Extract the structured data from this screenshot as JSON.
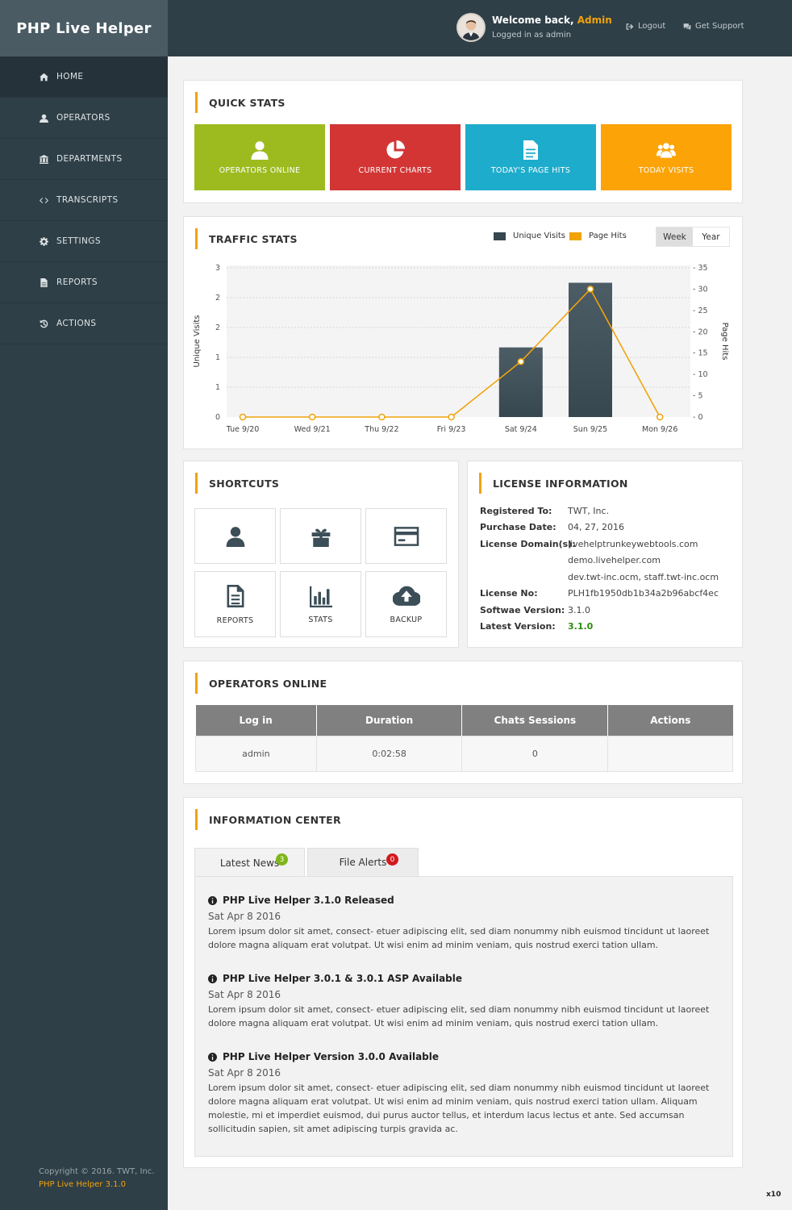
{
  "brand": "PHP Live Helper",
  "sidebar": {
    "items": [
      {
        "label": "HOME",
        "icon": "home-icon"
      },
      {
        "label": "OPERATORS",
        "icon": "user-icon"
      },
      {
        "label": "DEPARTMENTS",
        "icon": "bank-icon"
      },
      {
        "label": "TRANSCRIPTS",
        "icon": "code-icon"
      },
      {
        "label": "SETTINGS",
        "icon": "gear-icon"
      },
      {
        "label": "REPORTS",
        "icon": "file-icon"
      },
      {
        "label": "ACTIONS",
        "icon": "history-icon"
      }
    ],
    "copyright": "Copyright © 2016. TWT, Inc.",
    "version": "PHP Live Helper 3.1.0"
  },
  "header": {
    "welcome": "Welcome back,",
    "user": "Admin",
    "logged_in": "Logged in as admin",
    "logout": "Logout",
    "support": "Get Support"
  },
  "quick_stats": {
    "title": "QUICK STATS",
    "tiles": [
      {
        "label": "OPERATORS ONLINE",
        "color": "#9dbb1f",
        "icon": "user-icon"
      },
      {
        "label": "CURRENT CHARTS",
        "color": "#d33535",
        "icon": "pie-chart-icon"
      },
      {
        "label": "TODAY'S PAGE HITS",
        "color": "#1eaccc",
        "icon": "document-icon"
      },
      {
        "label": "TODAY VISITS",
        "color": "#fca308",
        "icon": "users-icon"
      }
    ]
  },
  "traffic": {
    "title": "TRAFFIC STATS",
    "legend_visits": "Unique Visits",
    "legend_hits": "Page Hits",
    "week": "Week",
    "year": "Year"
  },
  "chart_data": {
    "type": "bar",
    "categories": [
      "Tue 9/20",
      "Wed 9/21",
      "Thu 9/22",
      "Fri 9/23",
      "Sat 9/24",
      "Sun 9/25",
      "Mon 9/26"
    ],
    "series": [
      {
        "name": "Unique Visits",
        "type": "bar",
        "axis": "left",
        "color": "#37474f",
        "values": [
          0,
          0,
          0,
          0,
          1.4,
          2.7,
          0
        ]
      },
      {
        "name": "Page Hits",
        "type": "line",
        "axis": "right",
        "color": "#f0a30a",
        "values": [
          0,
          0,
          0,
          0,
          13,
          30,
          0
        ]
      }
    ],
    "ylabel": "Unique Visits",
    "y2label": "Page Hits",
    "yticks": [
      "3",
      "2",
      "2",
      "1",
      "1",
      "0"
    ],
    "ylim": [
      0,
      3
    ],
    "y2ticks": [
      "35",
      "30",
      "25",
      "20",
      "15",
      "10",
      "5",
      "0"
    ],
    "y2lim": [
      0,
      35
    ],
    "grid": true,
    "legend": "top-right"
  },
  "shortcuts": {
    "title": "SHORTCUTS",
    "items": [
      {
        "label": "",
        "icon": "user-icon"
      },
      {
        "label": "",
        "icon": "gift-icon"
      },
      {
        "label": "",
        "icon": "credit-card-icon"
      },
      {
        "label": "REPORTS",
        "icon": "document-icon"
      },
      {
        "label": "STATS",
        "icon": "bar-chart-icon"
      },
      {
        "label": "BACKUP",
        "icon": "cloud-upload-icon"
      }
    ]
  },
  "license": {
    "title": "LICENSE INFORMATION",
    "registered_to_label": "Registered To:",
    "registered_to": "TWT, Inc.",
    "purchase_date_label": "Purchase Date:",
    "purchase_date": "04, 27, 2016",
    "domains_label": "License Domain(s):",
    "domain1": "livehelptrunkeywebtools.com",
    "domain2": "demo.livehelper.com",
    "domain3": "dev.twt-inc.ocm,  staff.twt-inc.ocm",
    "license_no_label": "License No:",
    "license_no": "PLH1fb1950db1b34a2b96abcf4ec",
    "software_version_label": "Softwae Version:",
    "software_version": "3.1.0",
    "latest_version_label": "Latest Version:",
    "latest_version": "3.1.0",
    "latest_color": "#2e8b0e"
  },
  "operators": {
    "title": "OPERATORS ONLINE",
    "columns": [
      "Log in",
      "Duration",
      "Chats Sessions",
      "Actions"
    ],
    "rows": [
      [
        "admin",
        "0:02:58",
        "0",
        ""
      ]
    ]
  },
  "info": {
    "title": "INFORMATION CENTER",
    "tab_news": "Latest News",
    "news_count": "3",
    "tab_alerts": "File Alerts",
    "alerts_count": "0",
    "news": [
      {
        "title": "PHP Live Helper 3.1.0 Released",
        "date": "Sat Apr 8 2016",
        "body": "Lorem ipsum dolor sit amet, consect- etuer adipiscing elit, sed diam nonummy nibh euismod tincidunt ut laoreet dolore magna aliquam erat volutpat. Ut wisi enim ad minim veniam, quis nostrud exerci tation ullam."
      },
      {
        "title": "PHP Live Helper 3.0.1 & 3.0.1 ASP Available",
        "date": "Sat Apr 8 2016",
        "body": "Lorem ipsum dolor sit amet, consect- etuer adipiscing elit, sed diam nonummy nibh euismod tincidunt ut laoreet dolore magna aliquam erat volutpat. Ut wisi enim ad minim veniam, quis nostrud exerci tation ullam."
      },
      {
        "title": "PHP Live Helper Version 3.0.0 Available",
        "date": "Sat Apr 8 2016",
        "body": "Lorem ipsum dolor sit amet, consect- etuer adipiscing elit, sed diam nonummy nibh euismod tincidunt ut laoreet dolore magna aliquam erat volutpat. Ut wisi enim ad minim veniam, quis nostrud exerci tation ullam. Aliquam molestie, mi et imperdiet euismod, dui purus auctor tellus, et interdum lacus lectus et ante. Sed accumsan sollicitudin sapien, sit amet adipiscing turpis gravida ac."
      }
    ]
  },
  "corner_label": "x10"
}
